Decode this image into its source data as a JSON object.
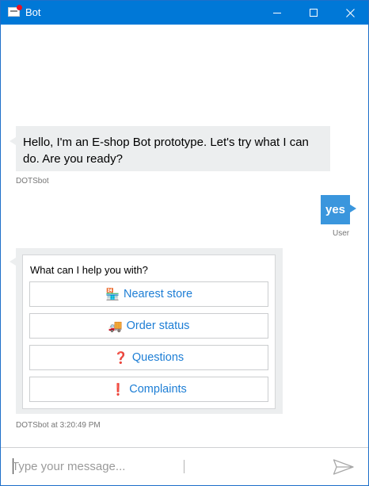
{
  "window": {
    "title": "Bot"
  },
  "chat": {
    "messages": [
      {
        "from": "bot",
        "text": "Hello, I'm an E-shop Bot prototype. Let's try what I can do. Are you ready?",
        "meta": "DOTSbot"
      },
      {
        "from": "user",
        "text": "yes",
        "meta": "User"
      },
      {
        "from": "bot",
        "card": {
          "text": "What can I help you with?",
          "buttons": [
            {
              "icon": "store-icon",
              "glyph": "🏪",
              "label": "Nearest store"
            },
            {
              "icon": "truck-icon",
              "glyph": "🚚",
              "label": "Order status"
            },
            {
              "icon": "question-icon",
              "glyph": "❓",
              "label": "Questions"
            },
            {
              "icon": "exclamation-icon",
              "glyph": "❗",
              "label": "Complaints"
            }
          ]
        },
        "meta": "DOTSbot at 3:20:49 PM"
      }
    ]
  },
  "composer": {
    "placeholder": "Type your message..."
  },
  "colors": {
    "titlebar": "#0078d7",
    "user_bubble": "#3a96dd",
    "bot_bubble": "#eceeef",
    "link": "#1d7ed5"
  }
}
